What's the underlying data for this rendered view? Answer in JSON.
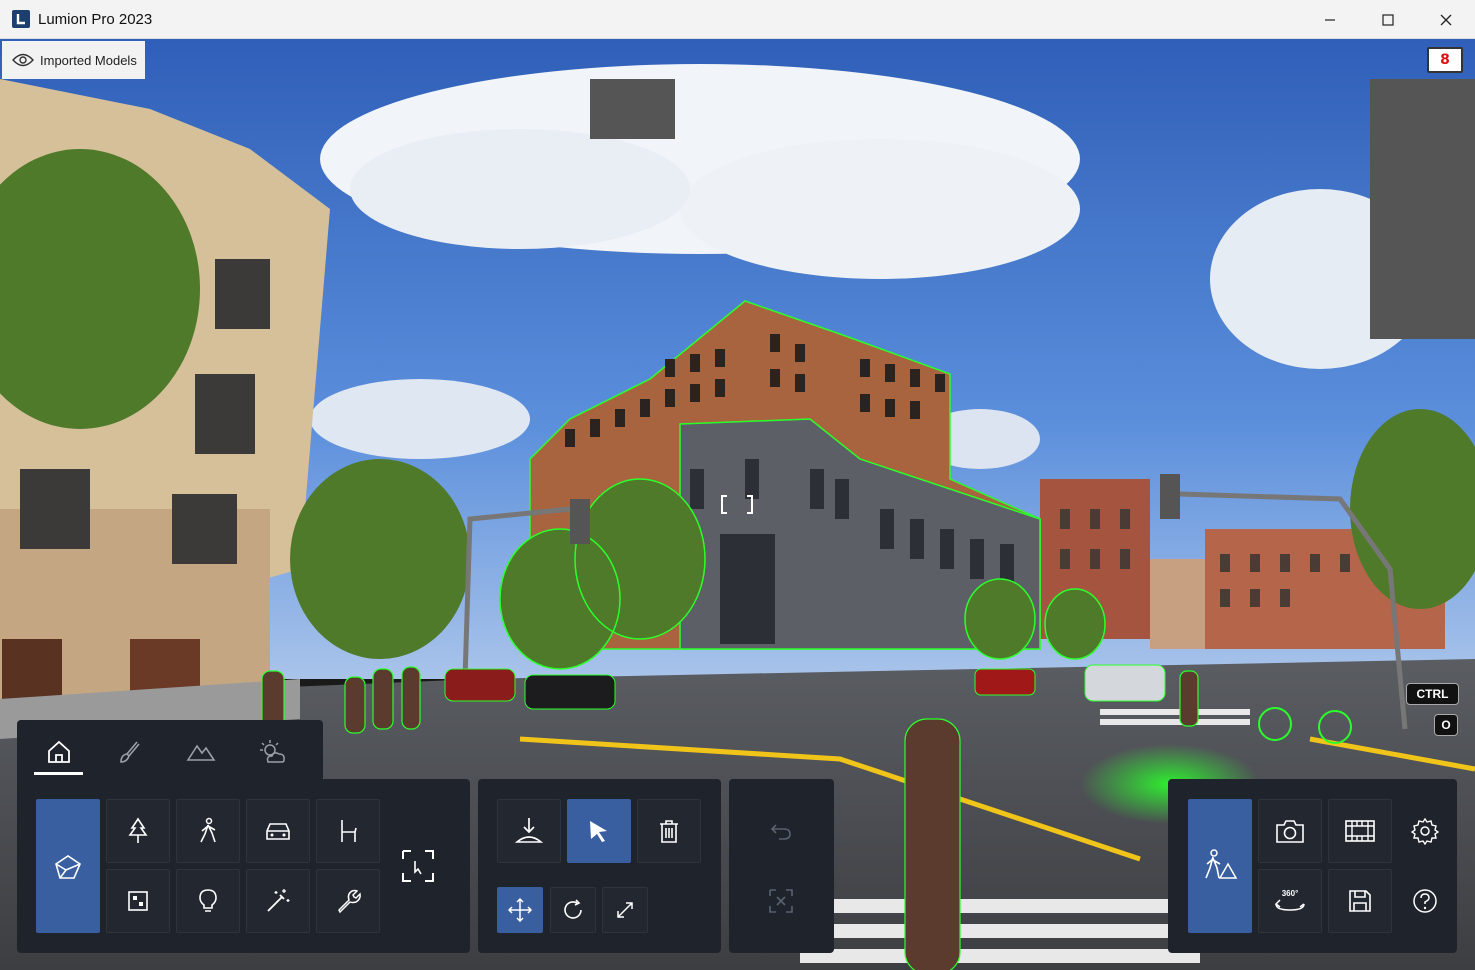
{
  "window": {
    "title": "Lumion Pro 2023",
    "controls": [
      "minimize",
      "maximize",
      "close"
    ]
  },
  "viewport": {
    "imported_models_label": "Imported Models",
    "counter_badge": "8",
    "key_hints": [
      "CTRL",
      "O"
    ]
  },
  "colors": {
    "panel_bg": "#1f232b",
    "active_blue": "#3a5fa0",
    "selection_green": "#2bff2b"
  },
  "tabs": [
    {
      "name": "home",
      "icon": "home-icon",
      "active": true
    },
    {
      "name": "materials",
      "icon": "brush-icon",
      "active": false
    },
    {
      "name": "landscape",
      "icon": "mountain-icon",
      "active": false
    },
    {
      "name": "weather",
      "icon": "sun-cloud-icon",
      "active": false
    }
  ],
  "object_tools": [
    "import-model-icon",
    "tree-icon",
    "person-icon",
    "car-icon",
    "chair-icon",
    "select-area-icon",
    "box-dot-icon",
    "lightbulb-icon",
    "magic-wand-icon",
    "wrench-icon"
  ],
  "edit_tools": [
    "place-icon",
    "select-arrow-icon",
    "trash-icon",
    "move-icon",
    "rotate-icon",
    "scale-icon"
  ],
  "history_tools": [
    "undo-icon",
    "deselect-icon"
  ],
  "mode_tools": [
    "build-mode-icon",
    "photo-icon",
    "movie-icon",
    "settings-icon",
    "panorama-360-icon",
    "save-icon",
    "help-icon"
  ]
}
